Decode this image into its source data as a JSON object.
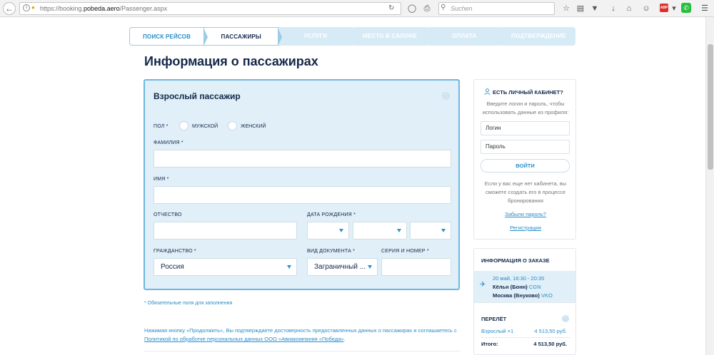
{
  "browser": {
    "url_prefix": "https://booking.",
    "url_host": "pobeda.aero",
    "url_path": "/Passenger.aspx",
    "search_placeholder": "Suchen",
    "adblock_label": "ABP"
  },
  "steps": [
    {
      "label": "Поиск рейсов"
    },
    {
      "label": "Пассажиры"
    },
    {
      "label": "Услуги"
    },
    {
      "label": "Место в салоне"
    },
    {
      "label": "Оплата"
    },
    {
      "label": "Подтверждение"
    }
  ],
  "page_title": "Информация о пассажирах",
  "passenger_form": {
    "title": "Взрослый пассажир",
    "gender_label": "Пол *",
    "gender_male": "Мужской",
    "gender_female": "Женский",
    "surname_label": "Фамилия *",
    "surname_value": "",
    "name_label": "Имя *",
    "name_value": "",
    "patronymic_label": "Отчество",
    "patronymic_value": "",
    "birthdate_label": "Дата рождения *",
    "citizenship_label": "Гражданство *",
    "citizenship_value": "Россия",
    "doc_type_label": "Вид документа *",
    "doc_type_value": "Заграничный ...",
    "doc_number_label": "Серия и номер *",
    "doc_number_value": ""
  },
  "required_note": "* Обязательные поля для заполнения",
  "consent": {
    "text_before": "Нажимая кнопку «Продолжить», Вы подтверждаете достоверность предоставленных данных о пассажирах и соглашаетесь с ",
    "link": "Политикой по обработке персональных данных ООО «Авиакомпания «Победа»",
    "text_after": "."
  },
  "login": {
    "header": "Есть личный кабинет?",
    "description": "Введите логин и пароль, чтобы использовать данные из профиля:",
    "login_placeholder": "Логин",
    "password_placeholder": "Пароль",
    "login_button": "Войти",
    "no_account_note": "Если у вас еще нет кабинета, вы сможете создать его в процессе бронирования",
    "forgot_link": "Забыли пароль?",
    "register_link": "Регистрация"
  },
  "order": {
    "header": "Информация о заказе",
    "flight_date": "20 май, 16:30 - 20:35",
    "from_city": "Кёльн (Бонн)",
    "from_code": "CGN",
    "to_city": "Москва (Внуково)",
    "to_code": "VKO",
    "section_title": "Перелёт",
    "passenger_line": "Взрослый ×1",
    "passenger_price": "4 513,50 руб.",
    "total_label": "Итого:",
    "total_value": "4 513,50 руб."
  }
}
